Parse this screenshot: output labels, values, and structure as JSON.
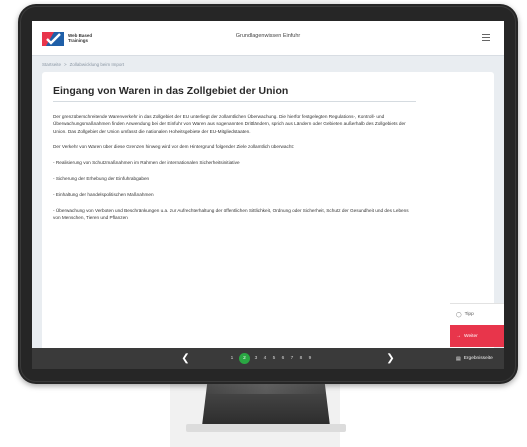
{
  "header": {
    "logo_text": "Web Based Trainings",
    "title": "Grundlagenwissen Einfuhr"
  },
  "breadcrumb": {
    "home": "Startseite",
    "separator": ">",
    "current": "Zollabwicklung beim Import"
  },
  "page": {
    "heading": "Eingang von Waren in das Zollgebiet der Union",
    "paragraphs": [
      "Der grenzüberschreitende Warenverkehr in das Zollgebiet der EU unterliegt der zollamtlichen Überwachung. Die hierfür festgelegten Regulations-, Kontroll- und Überwachungsmaßnahmen finden Anwendung bei der Einfuhr von Waren aus sogenannten Drittländern, sprich aus Ländern oder Gebieten außerhalb des Zollgebiets der Union. Das Zollgebiet der Union umfasst die nationalen Hoheitsgebiete der EU-Mitgliedstaaten.",
      "Der Verkehr von Waren über diese Grenzen hinweg wird vor dem Hintergrund folgender Ziele zollamtlich überwacht:",
      "- Realisierung von Schutzmaßnahmen im Rahmen der internationalen Sicherheitsinitiative",
      "- Sicherung der Erhebung der Einfuhrabgaben",
      "- Einhaltung der handelspolitischen Maßnahmen",
      "- Überwachung von Verboten und Beschränkungen u.a. zur Aufrechterhaltung der öffentlichen Sittlichkeit, Ordnung oder Sicherheit, Schutz der Gesundheit und des Lebens von Menschen, Tieren und Pflanzen"
    ]
  },
  "side_buttons": {
    "tipp": "Tipp",
    "weiter": "Weiter",
    "ergebnis": "Ergebnisseite"
  },
  "navigation": {
    "prev_icon": "chevron-left-icon",
    "next_icon": "chevron-right-icon",
    "pages": [
      "1",
      "2",
      "3",
      "4",
      "5",
      "6",
      "7",
      "8",
      "9"
    ],
    "current_page": "2"
  },
  "colors": {
    "accent_red": "#e8354b",
    "active_page_green": "#2aa743",
    "navbar_dark": "#3a3a3a"
  }
}
